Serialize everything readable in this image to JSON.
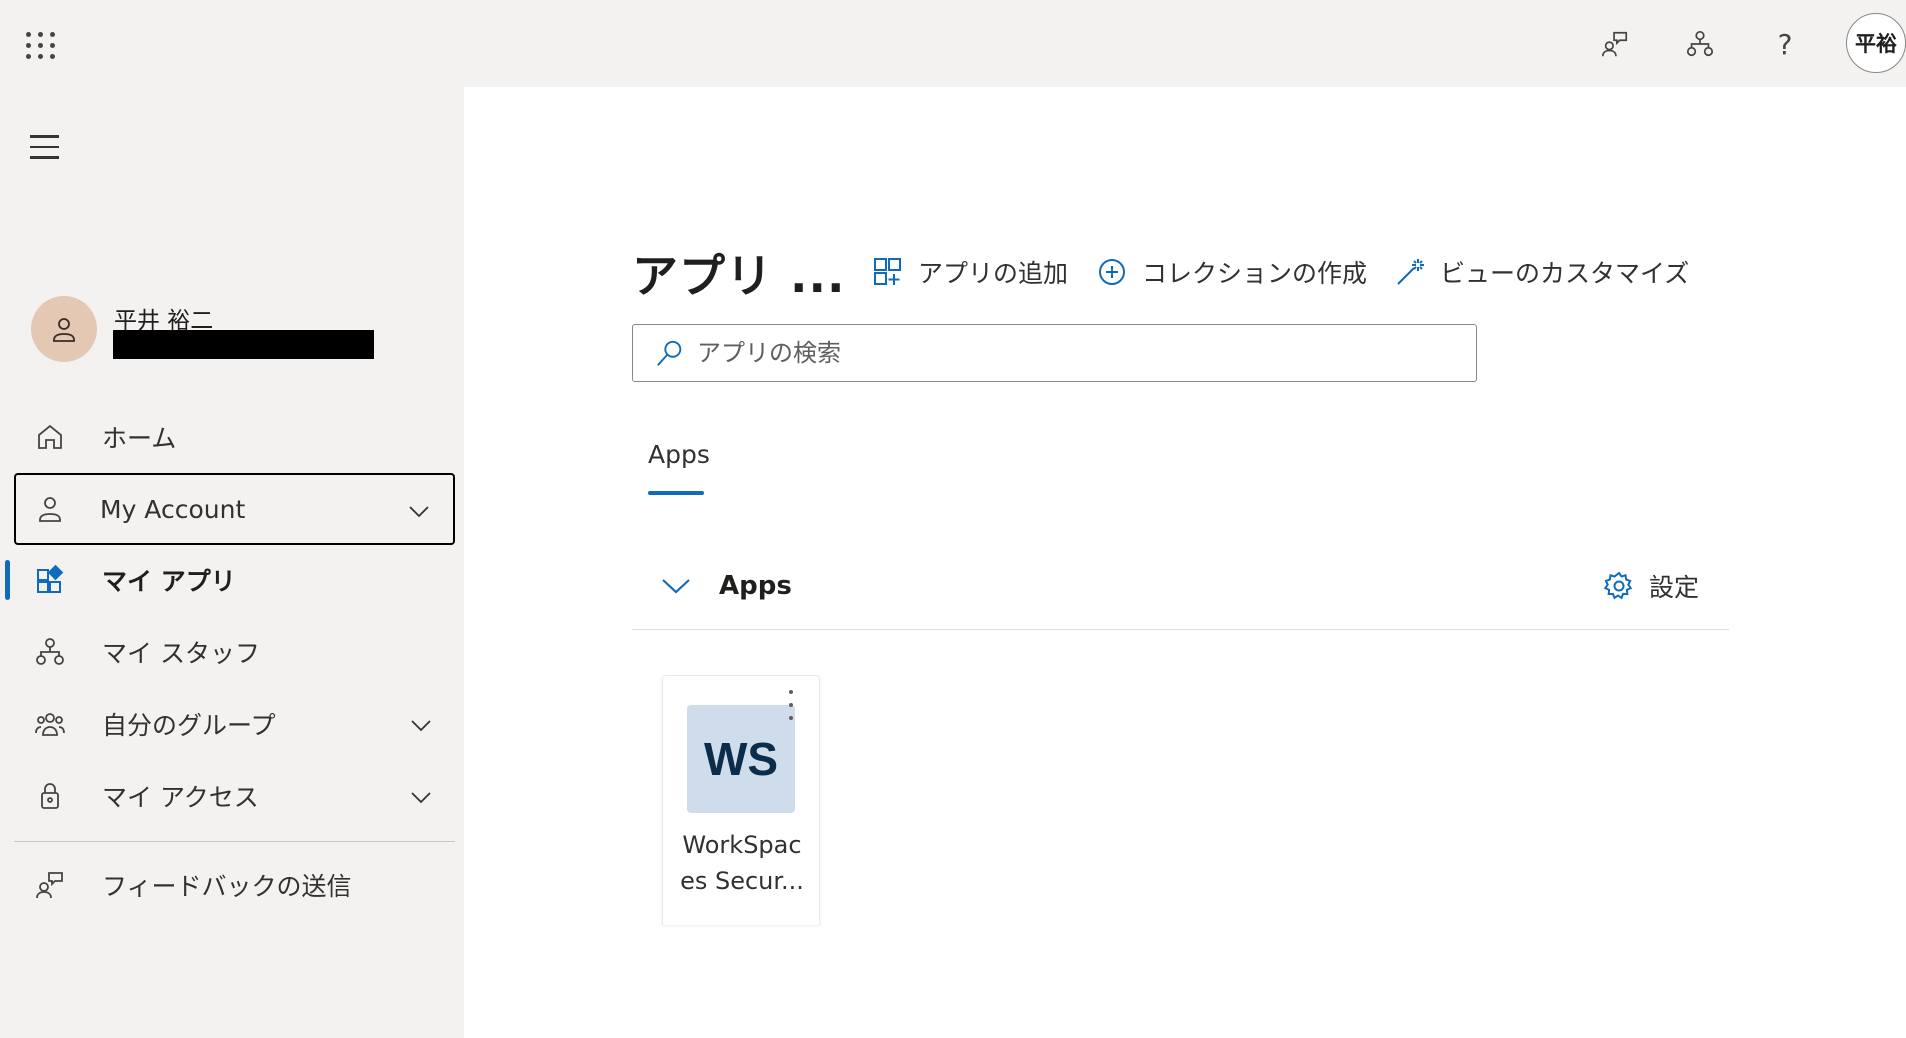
{
  "topbar": {
    "waffle_icon": "waffle-icon",
    "icons": [
      "feedback-icon",
      "org-icon",
      "help-icon"
    ],
    "help_glyph": "?",
    "avatar_initials": "平裕"
  },
  "sidebar": {
    "profile_name": "平井 裕二",
    "items": [
      {
        "label": "ホーム",
        "icon": "home-icon"
      },
      {
        "label": "My Account",
        "icon": "person-icon"
      },
      {
        "label": "マイ アプリ",
        "icon": "apps-icon"
      },
      {
        "label": "マイ スタッフ",
        "icon": "org-icon"
      },
      {
        "label": "自分のグループ",
        "icon": "group-icon"
      },
      {
        "label": "マイ アクセス",
        "icon": "lock-icon"
      },
      {
        "label": "フィードバックの送信",
        "icon": "feedback-icon"
      }
    ]
  },
  "main": {
    "title": "アプリ ...",
    "commands": {
      "add_app": "アプリの追加",
      "create_collection": "コレクションの作成",
      "customize_view": "ビューのカスタマイズ"
    },
    "search": {
      "placeholder": "アプリの検索",
      "value": ""
    },
    "tab": "Apps",
    "section": {
      "title": "Apps",
      "settings_label": "設定"
    },
    "apps": [
      {
        "tile_text": "WS",
        "name_line1": "WorkSpac",
        "name_line2": "es Secur..."
      }
    ]
  },
  "colors": {
    "accent": "#0f6cbd",
    "topbar_bg": "#f3f2f1",
    "sidebar_bg": "#f3f2f1",
    "app_tile_bg": "#cfdcec",
    "app_tile_text": "#0b2c4a",
    "profile_avatar_bg": "#e4c8b3"
  }
}
